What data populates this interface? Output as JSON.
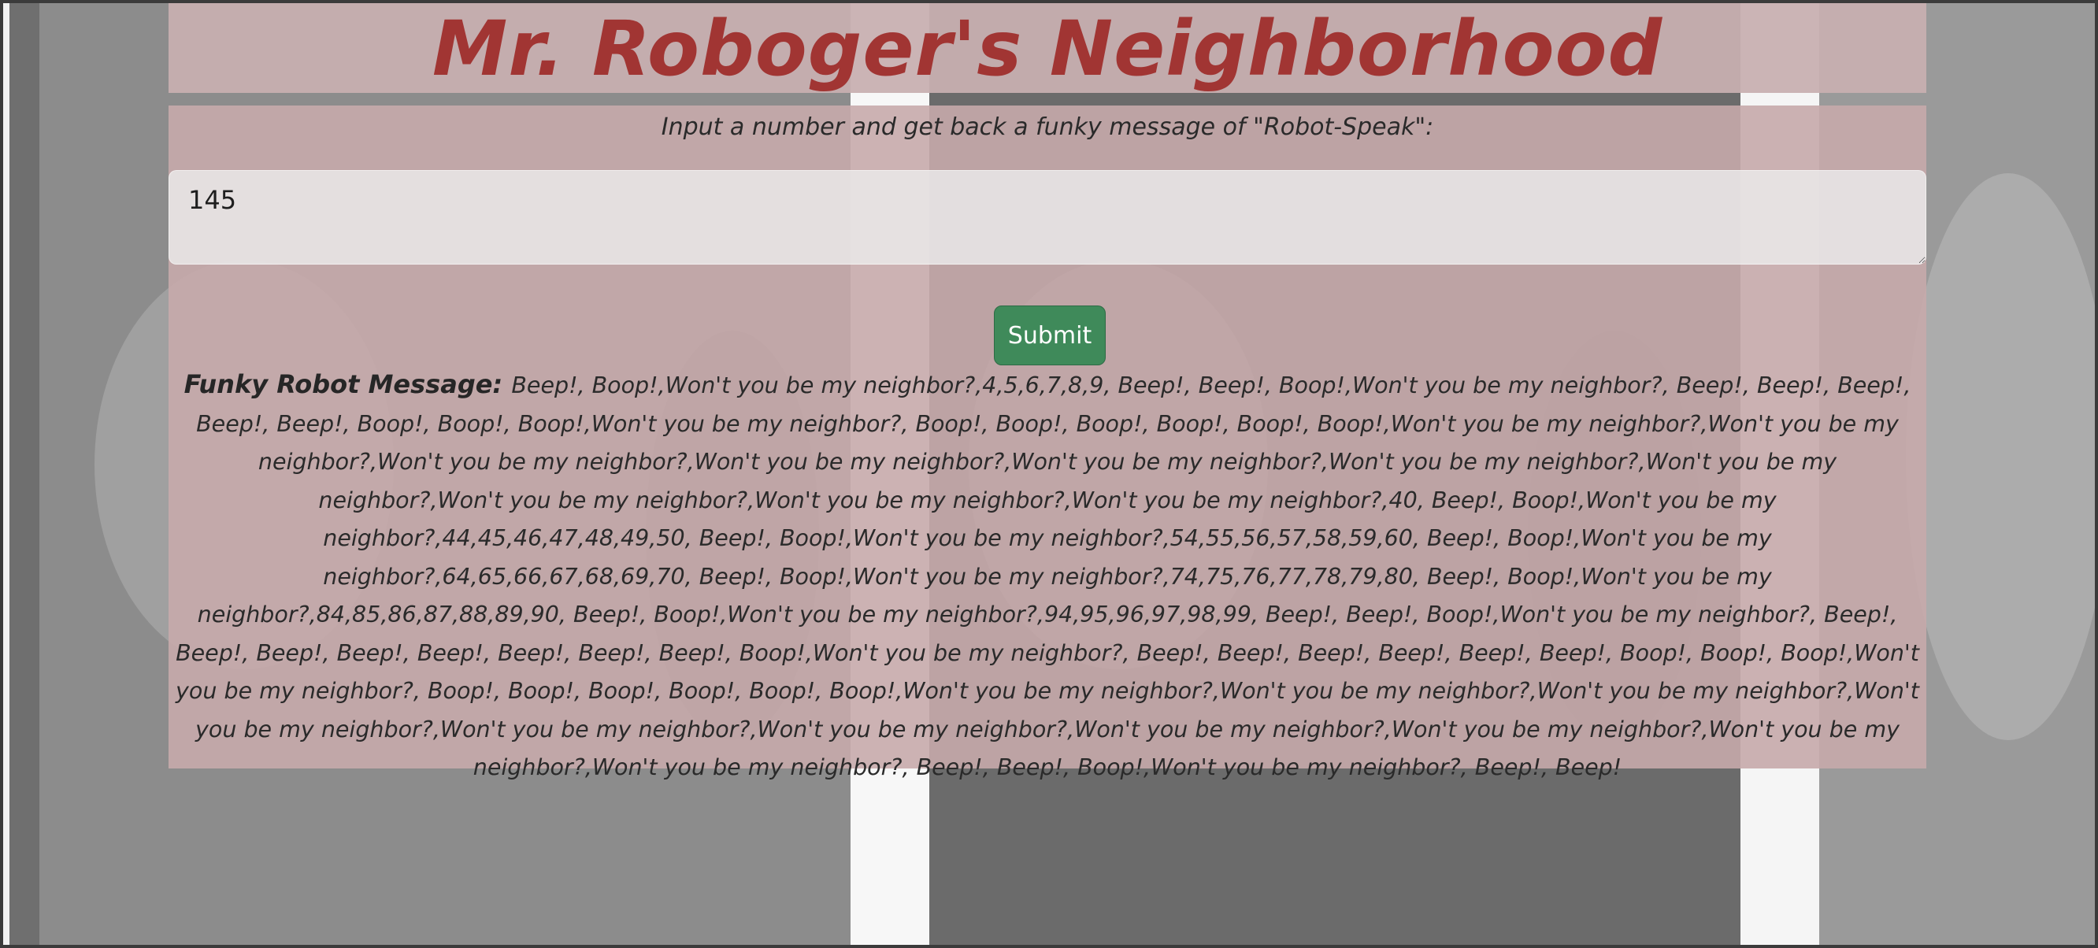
{
  "header": {
    "title": "Mr. Roboger's Neighborhood"
  },
  "form": {
    "prompt": "Input a number and get back a funky message of \"Robot-Speak\":",
    "input_value": "145",
    "submit_label": "Submit"
  },
  "result": {
    "label": "Funky Robot Message:",
    "message": "Beep!, Boop!,Won't you be my neighbor?,4,5,6,7,8,9, Beep!, Beep!, Boop!,Won't you be my neighbor?, Beep!, Beep!, Beep!, Beep!, Beep!, Boop!, Boop!, Boop!,Won't you be my neighbor?, Boop!, Boop!, Boop!, Boop!, Boop!, Boop!,Won't you be my neighbor?,Won't you be my neighbor?,Won't you be my neighbor?,Won't you be my neighbor?,Won't you be my neighbor?,Won't you be my neighbor?,Won't you be my neighbor?,Won't you be my neighbor?,Won't you be my neighbor?,Won't you be my neighbor?,40, Beep!, Boop!,Won't you be my neighbor?,44,45,46,47,48,49,50, Beep!, Boop!,Won't you be my neighbor?,54,55,56,57,58,59,60, Beep!, Boop!,Won't you be my neighbor?,64,65,66,67,68,69,70, Beep!, Boop!,Won't you be my neighbor?,74,75,76,77,78,79,80, Beep!, Boop!,Won't you be my neighbor?,84,85,86,87,88,89,90, Beep!, Boop!,Won't you be my neighbor?,94,95,96,97,98,99, Beep!, Beep!, Boop!,Won't you be my neighbor?, Beep!, Beep!, Beep!, Beep!, Beep!, Beep!, Beep!, Beep!, Boop!,Won't you be my neighbor?, Beep!, Beep!, Beep!, Beep!, Beep!, Beep!, Boop!, Boop!, Boop!,Won't you be my neighbor?, Boop!, Boop!, Boop!, Boop!, Boop!, Boop!,Won't you be my neighbor?,Won't you be my neighbor?,Won't you be my neighbor?,Won't you be my neighbor?,Won't you be my neighbor?,Won't you be my neighbor?,Won't you be my neighbor?,Won't you be my neighbor?,Won't you be my neighbor?,Won't you be my neighbor?, Beep!, Beep!, Boop!,Won't you be my neighbor?, Beep!, Beep!"
  },
  "colors": {
    "title": "#a13533",
    "panel": "#c6aaab",
    "button": "#3f8a5a"
  }
}
